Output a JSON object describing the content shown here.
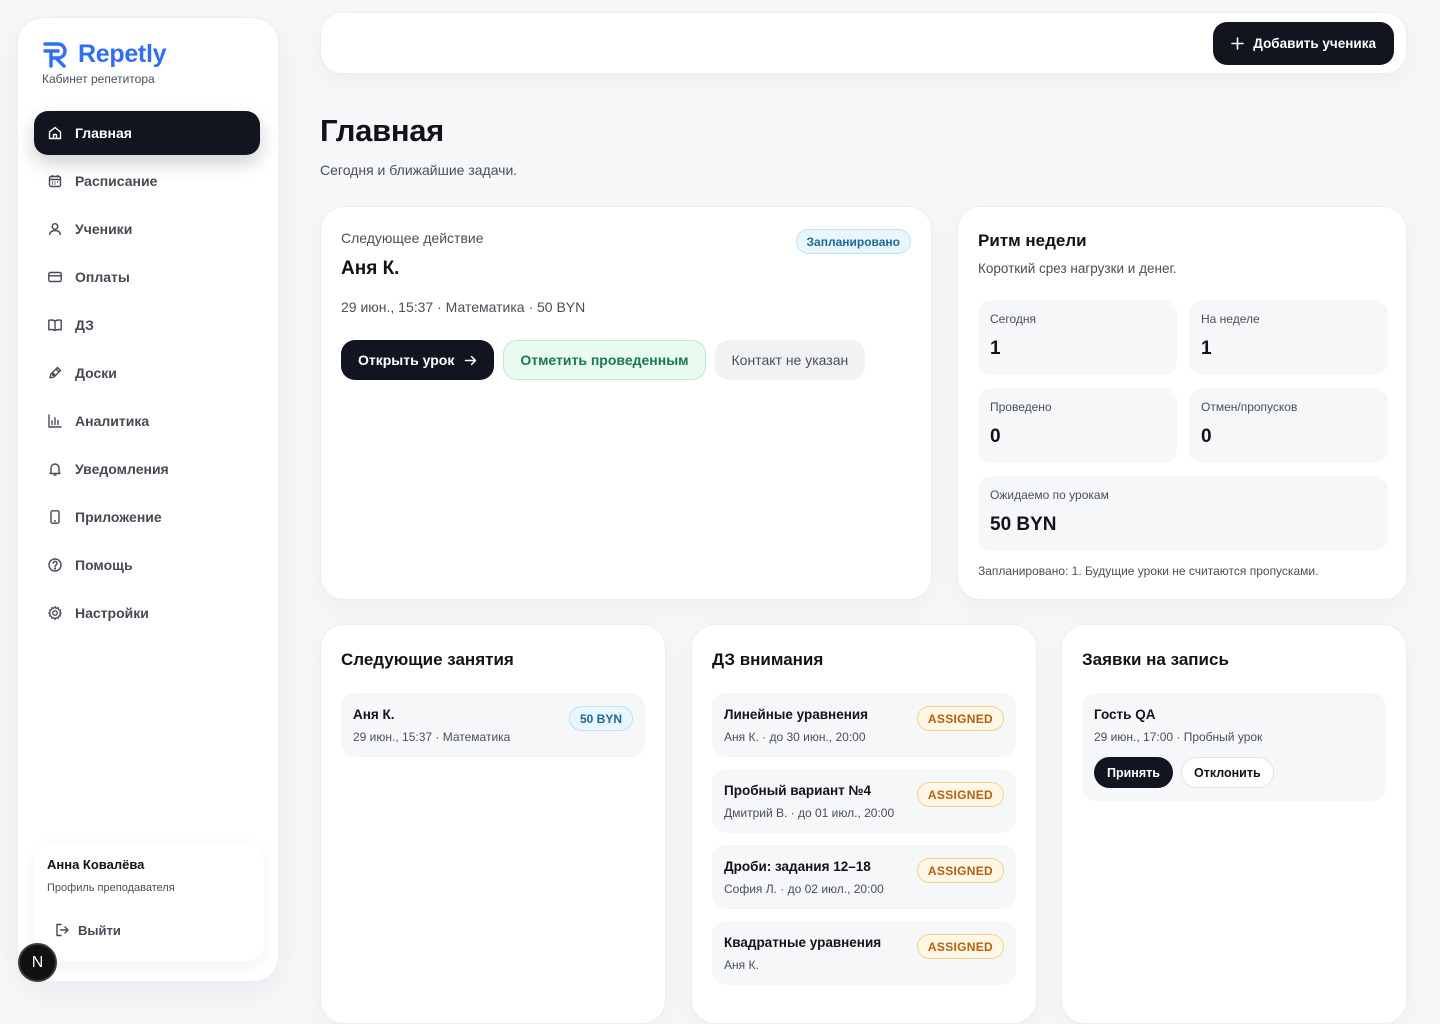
{
  "brand": {
    "name": "Repetly",
    "subtitle": "Кабинет репетитора",
    "color": "#2f6ff0"
  },
  "sidebar": {
    "items": [
      {
        "label": "Главная",
        "icon": "home-icon",
        "active": true
      },
      {
        "label": "Расписание",
        "icon": "calendar-icon"
      },
      {
        "label": "Ученики",
        "icon": "user-icon"
      },
      {
        "label": "Оплаты",
        "icon": "card-icon"
      },
      {
        "label": "ДЗ",
        "icon": "book-icon"
      },
      {
        "label": "Доски",
        "icon": "pen-icon"
      },
      {
        "label": "Аналитика",
        "icon": "chart-icon"
      },
      {
        "label": "Уведомления",
        "icon": "bell-icon"
      },
      {
        "label": "Приложение",
        "icon": "phone-icon"
      },
      {
        "label": "Помощь",
        "icon": "help-icon"
      },
      {
        "label": "Настройки",
        "icon": "gear-icon"
      }
    ],
    "profile": {
      "name": "Анна Ковалёва",
      "role": "Профиль преподавателя",
      "logout": "Выйти"
    }
  },
  "dev_badge": "N",
  "topbar": {
    "add_student": "Добавить ученика"
  },
  "page": {
    "title": "Главная",
    "subtitle": "Сегодня и ближайшие задачи."
  },
  "next_action": {
    "label": "Следующее действие",
    "status": "Запланировано",
    "student": "Аня К.",
    "meta": "29 июн., 15:37 · Математика · 50 BYN",
    "open_lesson": "Открыть урок",
    "mark_done": "Отметить проведенным",
    "no_contact": "Контакт не указан"
  },
  "rhythm": {
    "title": "Ритм недели",
    "subtitle": "Короткий срез нагрузки и денег.",
    "stats": [
      {
        "label": "Сегодня",
        "value": "1"
      },
      {
        "label": "На неделе",
        "value": "1"
      },
      {
        "label": "Проведено",
        "value": "0"
      },
      {
        "label": "Отмен/пропусков",
        "value": "0"
      },
      {
        "label": "Ожидаемо по урокам",
        "value": "50 BYN"
      }
    ],
    "note": "Запланировано: 1. Будущие уроки не считаются пропусками."
  },
  "lessons": {
    "title": "Следующие занятия",
    "items": [
      {
        "name": "Аня К.",
        "meta": "29 июн., 15:37 · Математика",
        "badge": "50 BYN"
      }
    ]
  },
  "homework": {
    "title": "ДЗ внимания",
    "items": [
      {
        "title": "Линейные уравнения",
        "meta": "Аня К. · до 30 июн., 20:00",
        "badge": "ASSIGNED"
      },
      {
        "title": "Пробный вариант №4",
        "meta": "Дмитрий В. · до 01 июл., 20:00",
        "badge": "ASSIGNED"
      },
      {
        "title": "Дроби: задания 12–18",
        "meta": "София Л. · до 02 июл., 20:00",
        "badge": "ASSIGNED"
      },
      {
        "title": "Квадратные уравнения",
        "meta": "Аня К.",
        "badge": "ASSIGNED"
      }
    ]
  },
  "requests": {
    "title": "Заявки на запись",
    "items": [
      {
        "name": "Гость QA",
        "meta": "29 июн., 17:00 · Пробный урок",
        "accept": "Принять",
        "decline": "Отклонить"
      }
    ]
  }
}
